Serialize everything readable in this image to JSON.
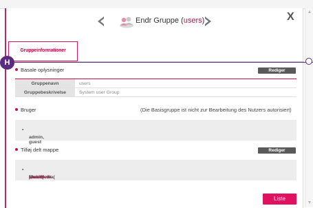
{
  "header": {
    "title_prefix": "Endr Gruppe (",
    "title_group": "users",
    "title_suffix": ")",
    "close_label": "X"
  },
  "tab": {
    "label": "Gruppeinformationer"
  },
  "badge": {
    "label": "H"
  },
  "basic": {
    "heading": "Basale oplysninger",
    "edit_label": "Rediger",
    "rows": [
      {
        "label": "Gruppenavn",
        "value": "users"
      },
      {
        "label": "Gruppebeskrivelse",
        "value": "System user Group"
      }
    ]
  },
  "users": {
    "heading": "Bruger",
    "note": "(Die Basisgruppe ist nicht zur Bearbeitung des Nutzers autorisiert)",
    "list": "admin, guest"
  },
  "shared": {
    "heading": "Tilføj delt mappe",
    "edit_label": "Rediger",
    "item1_name": "Share(",
    "item1_perm": "Læs/Skriv",
    "item1_close": "), ",
    "item2_name": "Multimedia(",
    "item2_perm": "Læs/Skriv",
    "item2_close": ")"
  },
  "footer": {
    "list_label": "Liste"
  },
  "colors": {
    "accent": "#c0104b",
    "badge": "#5c2a7e",
    "button_dark": "#5a5a5a",
    "button_pink": "#e0115f"
  }
}
